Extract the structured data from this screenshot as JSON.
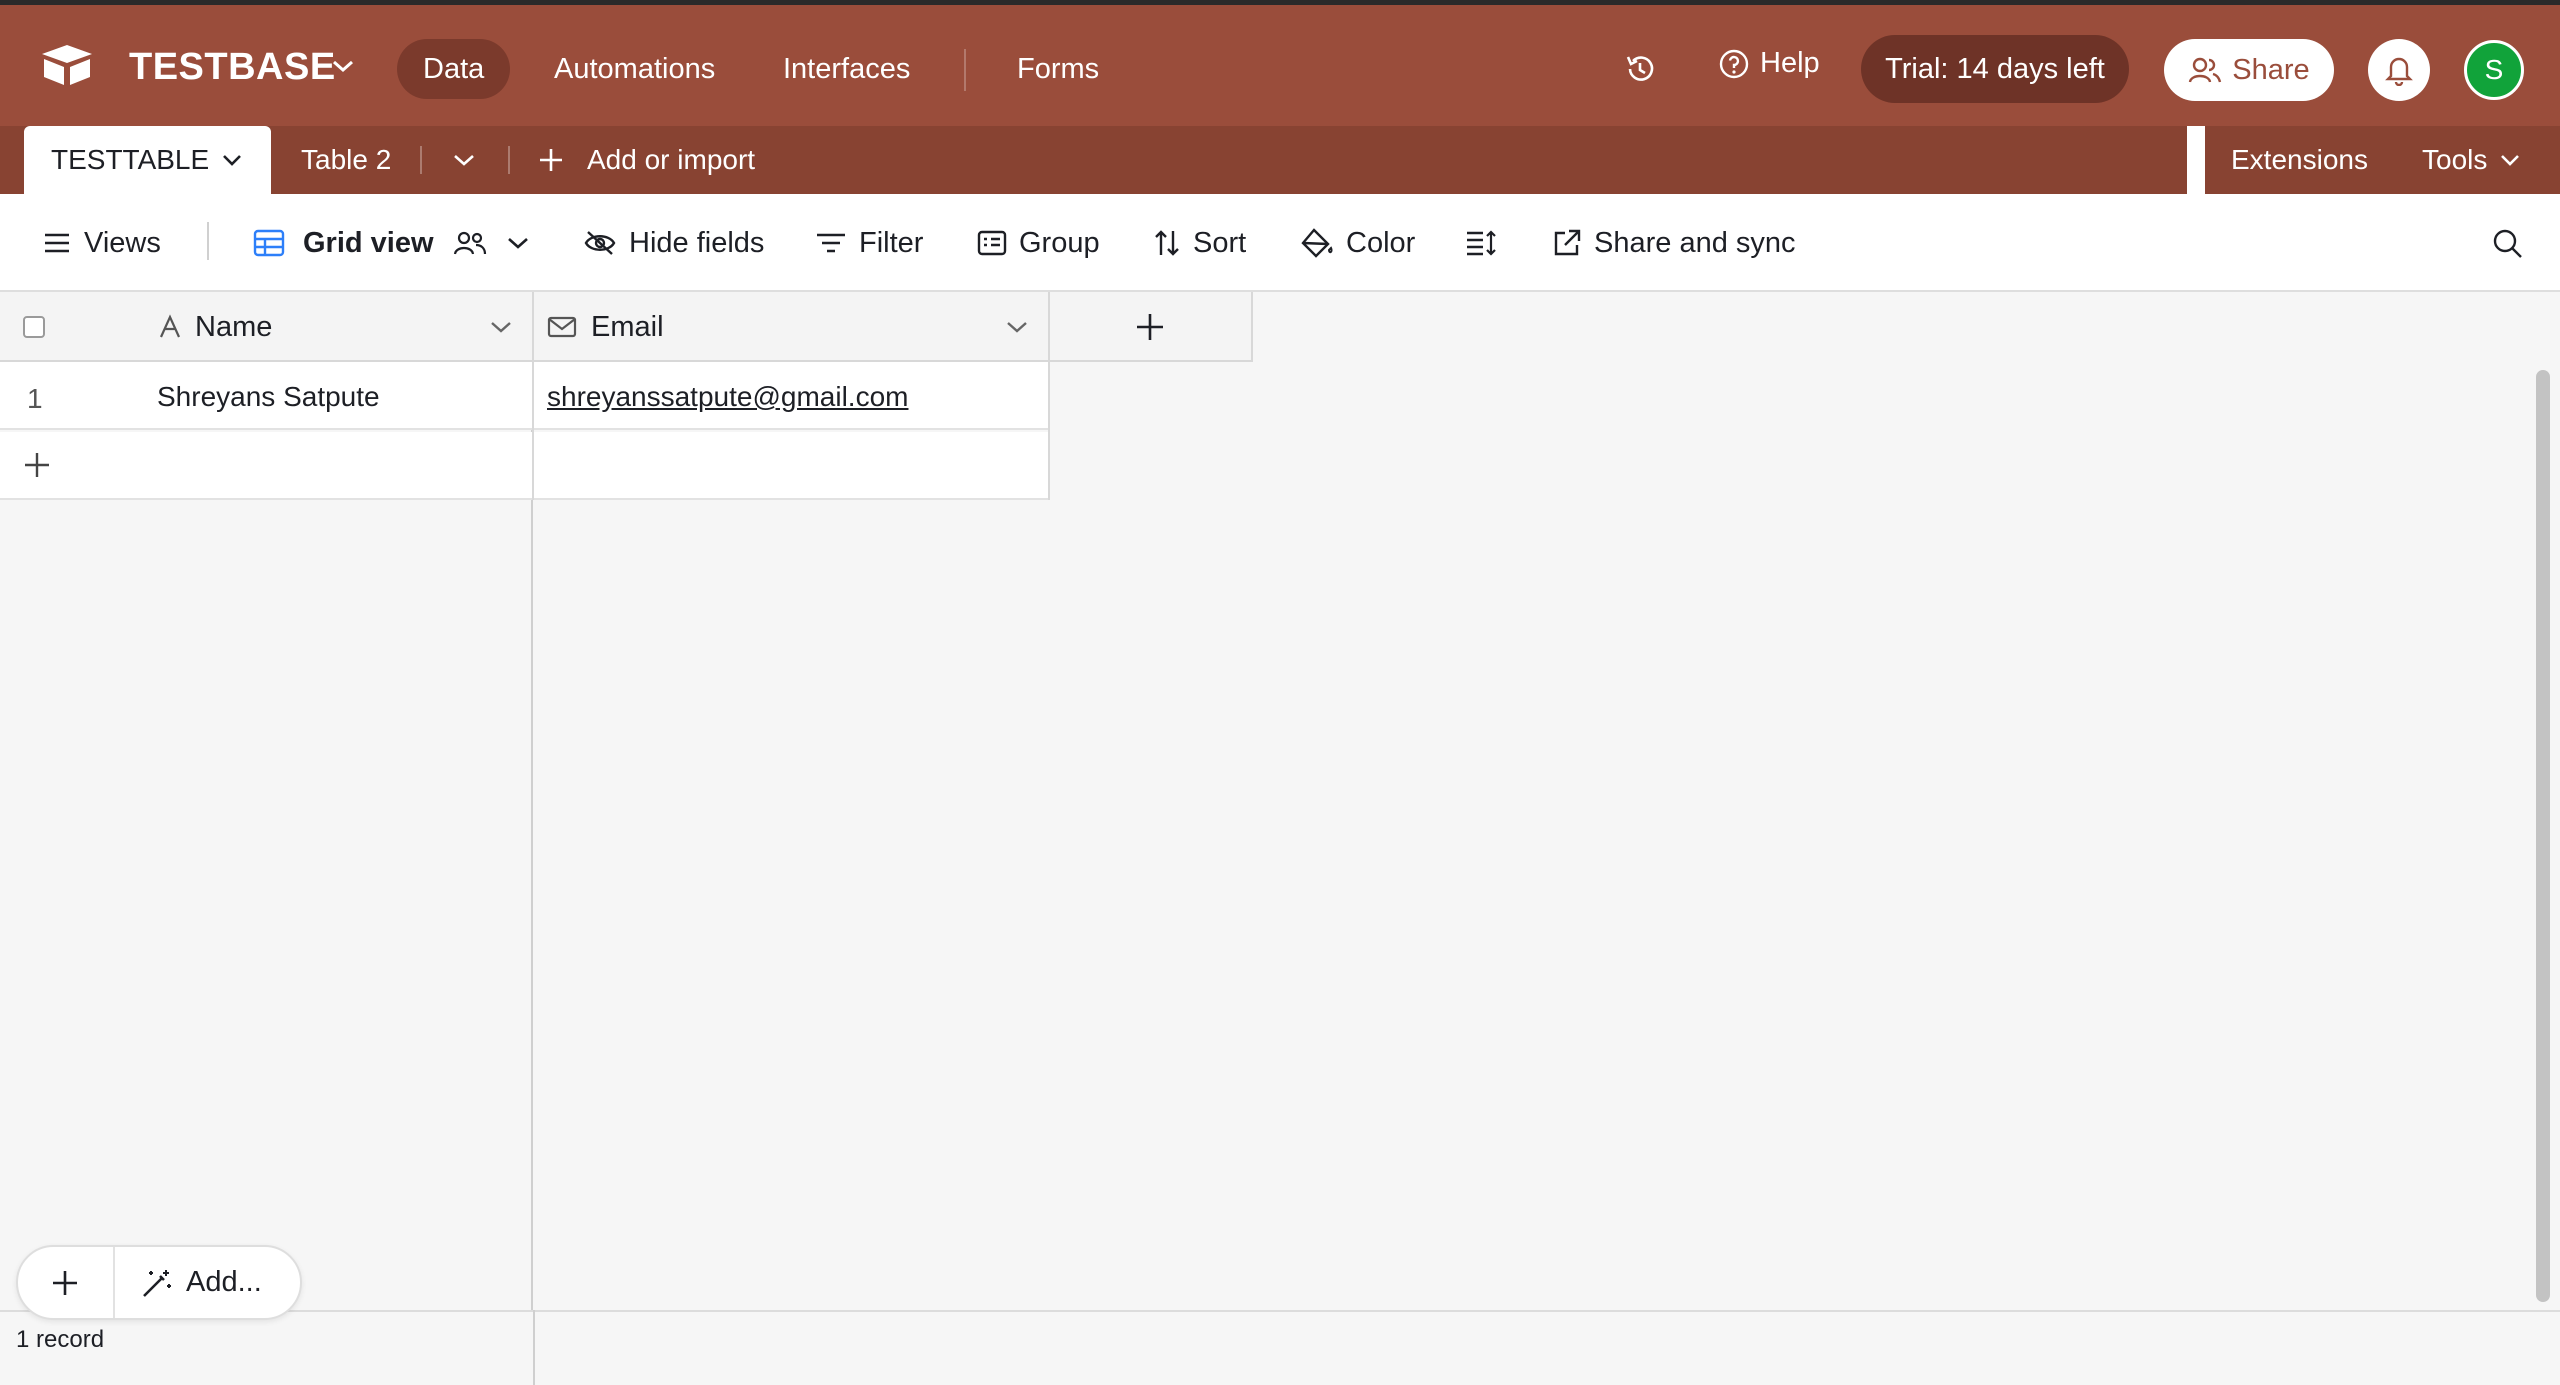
{
  "app": {
    "base_name": "TESTBASE",
    "nav": [
      "Data",
      "Automations",
      "Interfaces",
      "Forms"
    ],
    "active_nav": "Data",
    "help_label": "Help",
    "trial_label": "Trial: 14 days left",
    "share_label": "Share",
    "avatar_initial": "S",
    "brand_color": "#9a4d3b"
  },
  "tabs": {
    "active": "TESTTABLE",
    "second": "Table 2",
    "add_label": "Add or import",
    "extensions_label": "Extensions",
    "tools_label": "Tools"
  },
  "toolbar": {
    "views_label": "Views",
    "view_name": "Grid view",
    "hide_fields": "Hide fields",
    "filter": "Filter",
    "group": "Group",
    "sort": "Sort",
    "color": "Color",
    "share_sync": "Share and sync"
  },
  "grid": {
    "columns": [
      {
        "name": "Name",
        "icon": "text-field-icon"
      },
      {
        "name": "Email",
        "icon": "email-field-icon"
      }
    ],
    "rows": [
      {
        "number": "1",
        "name": "Shreyans Satpute",
        "email": "shreyanssatpute@gmail.com"
      }
    ]
  },
  "footer": {
    "add_label": "Add...",
    "record_count": "1 record"
  }
}
